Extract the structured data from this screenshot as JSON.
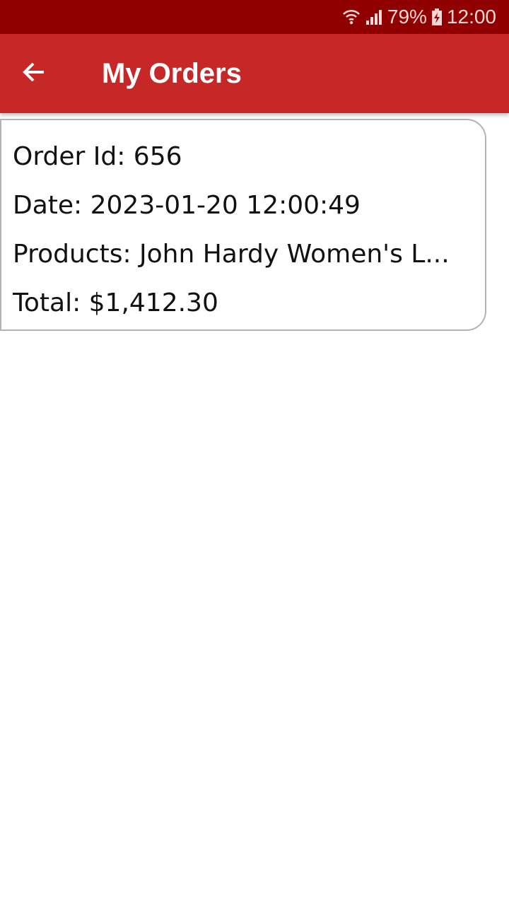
{
  "status_bar": {
    "battery_percent": "79%",
    "time": "12:00",
    "icons": [
      "wifi-icon",
      "signal-icon",
      "battery-charging-icon"
    ]
  },
  "app_bar": {
    "title": "My Orders",
    "back_icon": "arrow-left-icon"
  },
  "orders": [
    {
      "order_id": "Order Id: 656",
      "date": "Date: 2023-01-20 12:00:49",
      "products": "Products: John Hardy Women's L...",
      "total": "Total: $1,412.30"
    }
  ],
  "colors": {
    "status_bar": "#910000",
    "app_bar": "#c62828",
    "card_border": "#b3b3b3"
  }
}
